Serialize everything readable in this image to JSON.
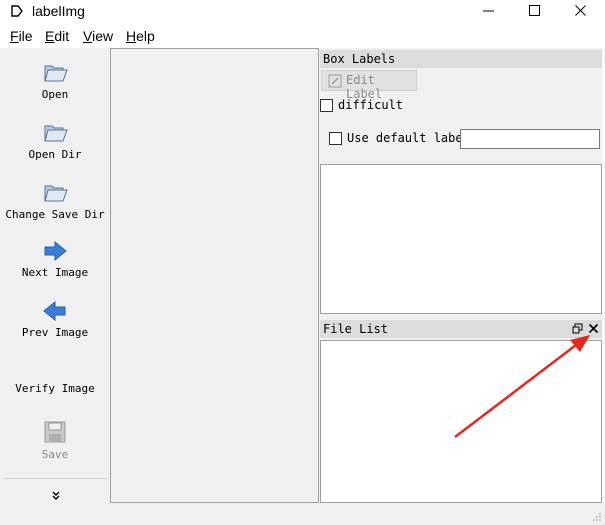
{
  "window": {
    "title": "labelImg",
    "icon": "labelimg-app-icon",
    "controls": [
      "minimize-icon",
      "maximize-icon",
      "close-icon"
    ]
  },
  "menu": {
    "file": "File",
    "edit": "Edit",
    "view": "View",
    "help": "Help"
  },
  "toolbar": {
    "open": {
      "label": "Open",
      "icon": "folder-open-icon"
    },
    "open_dir": {
      "label": "Open Dir",
      "icon": "folder-open-icon"
    },
    "change_save_dir": {
      "label": "Change Save Dir",
      "icon": "folder-open-icon"
    },
    "next_image": {
      "label": "Next Image",
      "icon": "arrow-right-icon"
    },
    "prev_image": {
      "label": "Prev Image",
      "icon": "arrow-left-icon"
    },
    "verify_image": {
      "label": "Verify Image"
    },
    "save": {
      "label": "Save",
      "icon": "save-icon",
      "enabled": false
    },
    "extension": {
      "icon": "chevron-double-down-icon"
    }
  },
  "box_labels": {
    "title": "Box Labels",
    "edit_label": "Edit Label",
    "difficult": "difficult",
    "use_default_label": "Use default label",
    "default_label_value": ""
  },
  "file_list": {
    "title": "File List",
    "float_icon": "float-icon",
    "close_icon": "close-icon"
  },
  "annotation": {
    "color": "#e8261e",
    "points_to": "file-list-close-button"
  },
  "colors": {
    "panel_bg": "#f0f0f0",
    "dock_title_bg": "#dcdcdc",
    "list_bg": "#ffffff",
    "arrow_blue": "#3a7dd6"
  }
}
